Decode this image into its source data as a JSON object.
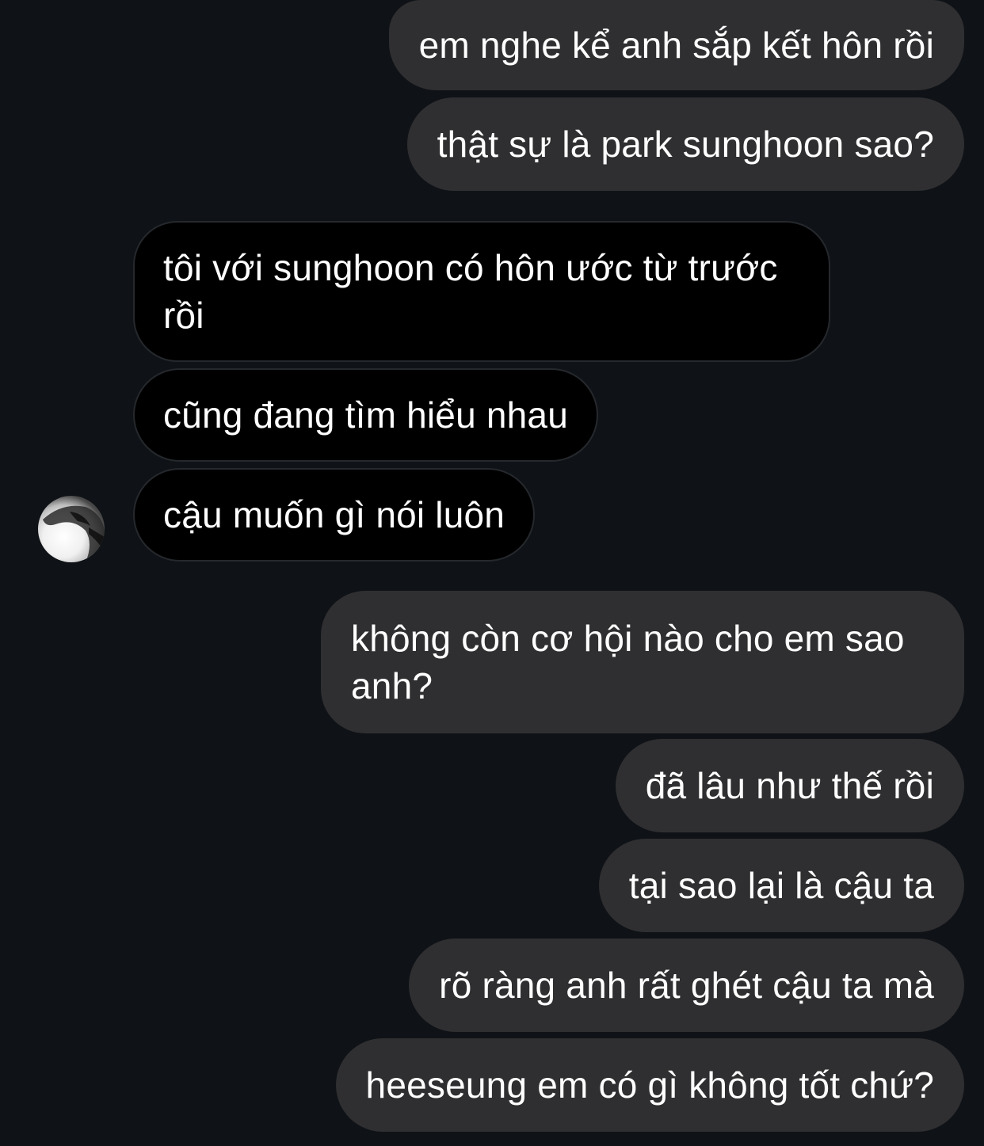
{
  "messages": [
    {
      "from": "me",
      "text": "em nghe kể anh sắp kết hôn rồi"
    },
    {
      "from": "me",
      "text": "thật sự là park sunghoon sao?"
    },
    {
      "from": "them",
      "text": "tôi với sunghoon có hôn ước từ trước rồi"
    },
    {
      "from": "them",
      "text": "cũng đang tìm hiểu nhau"
    },
    {
      "from": "them",
      "text": "cậu muốn gì nói luôn"
    },
    {
      "from": "me",
      "text": "không còn cơ hội nào cho em sao anh?"
    },
    {
      "from": "me",
      "text": "đã lâu như thế rồi"
    },
    {
      "from": "me",
      "text": "tại sao lại là cậu ta"
    },
    {
      "from": "me",
      "text": "rõ ràng anh rất ghét cậu ta mà"
    },
    {
      "from": "me",
      "text": "heeseung em có gì không tốt chứ?"
    }
  ],
  "colors": {
    "background": "#0f1216",
    "outgoing_bubble": "#2f2f31",
    "incoming_bubble": "#000000",
    "incoming_border": "#25282c",
    "text": "#ffffff"
  },
  "avatar": {
    "icon": "avatar-photo-grayscale"
  }
}
